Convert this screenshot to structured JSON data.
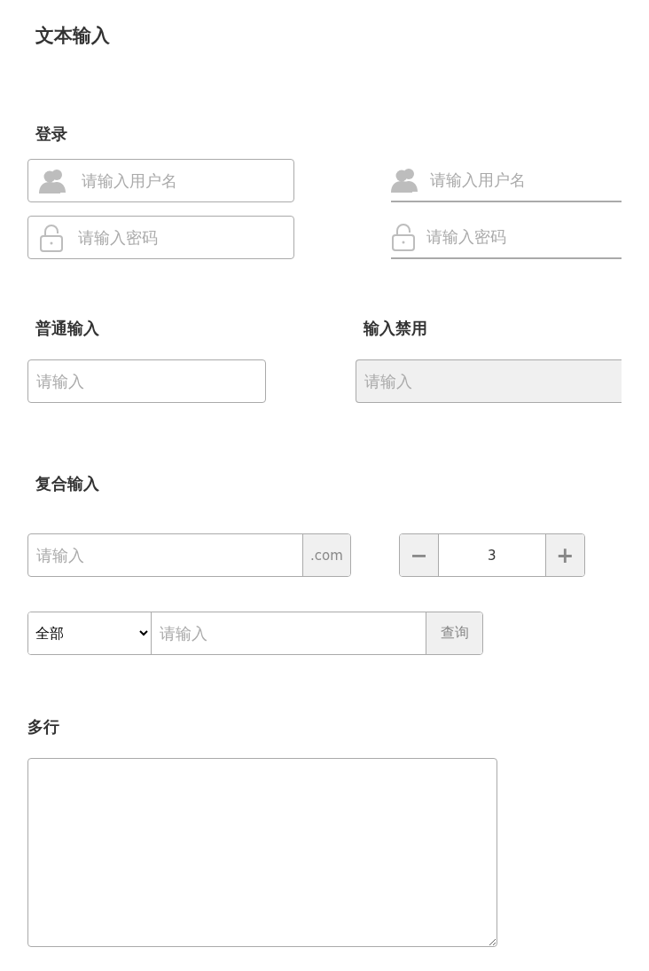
{
  "page_title": "文本输入",
  "login": {
    "title": "登录",
    "boxed": [
      {
        "kind": "user",
        "placeholder": "请输入用户名"
      },
      {
        "kind": "lock",
        "placeholder": "请输入密码"
      }
    ],
    "underlined": [
      {
        "kind": "user",
        "placeholder": "请输入用户名"
      },
      {
        "kind": "lock",
        "placeholder": "请输入密码"
      }
    ]
  },
  "normal": {
    "title": "普通输入",
    "placeholder": "请输入",
    "disabled": false
  },
  "disabled_input": {
    "title": "输入禁用",
    "placeholder": "请输入",
    "disabled": true
  },
  "compound": {
    "title": "复合输入",
    "suffix_field": {
      "placeholder": "请输入",
      "suffix": ".com"
    },
    "stepper": {
      "minus": "−",
      "value": "3",
      "plus": "+"
    },
    "search": {
      "select": "全部",
      "placeholder": "请输入",
      "button": "查询"
    }
  },
  "multiline": {
    "title": "多行"
  }
}
